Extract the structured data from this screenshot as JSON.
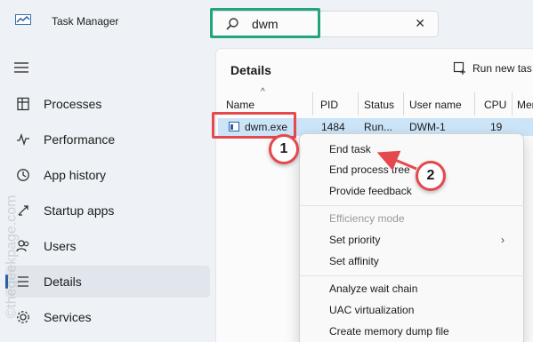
{
  "app": {
    "title": "Task Manager",
    "icon": "task-manager-icon"
  },
  "search": {
    "value": "dwm",
    "icon": "search-icon",
    "clear_icon": "close-icon",
    "clear_glyph": "✕"
  },
  "sidebar": {
    "items": [
      {
        "label": "Processes",
        "icon": "processes-icon",
        "active": false
      },
      {
        "label": "Performance",
        "icon": "performance-icon",
        "active": false
      },
      {
        "label": "App history",
        "icon": "app-history-icon",
        "active": false
      },
      {
        "label": "Startup apps",
        "icon": "startup-apps-icon",
        "active": false
      },
      {
        "label": "Users",
        "icon": "users-icon",
        "active": false
      },
      {
        "label": "Details",
        "icon": "details-icon",
        "active": true
      },
      {
        "label": "Services",
        "icon": "services-icon",
        "active": false
      }
    ]
  },
  "details": {
    "title": "Details",
    "run_new_task": "Run new tas",
    "columns": [
      "Name",
      "PID",
      "Status",
      "User name",
      "CPU",
      "Mer"
    ],
    "sort_glyph": "^",
    "selected_row": {
      "name": "dwm.exe",
      "pid": "1484",
      "status": "Run...",
      "user": "DWM-1",
      "cpu": "19"
    }
  },
  "context_menu": {
    "items": [
      {
        "label": "End task",
        "disabled": false
      },
      {
        "label": "End process tree",
        "disabled": false
      },
      {
        "label": "Provide feedback",
        "disabled": false
      },
      {
        "label": "Efficiency mode",
        "disabled": true
      },
      {
        "label": "Set priority",
        "disabled": false,
        "submenu": true
      },
      {
        "label": "Set affinity",
        "disabled": false
      },
      {
        "label": "Analyze wait chain",
        "disabled": false
      },
      {
        "label": "UAC virtualization",
        "disabled": false
      },
      {
        "label": "Create memory dump file",
        "disabled": false
      }
    ],
    "submenu_glyph": "›"
  },
  "annotations": {
    "step1": "1",
    "step2": "2"
  },
  "watermark": "©thegeekpage.com",
  "colors": {
    "accent": "#2b5fa8",
    "highlight_red": "#e5484d",
    "highlight_green": "#23a47a",
    "selection": "#cce4f7"
  }
}
